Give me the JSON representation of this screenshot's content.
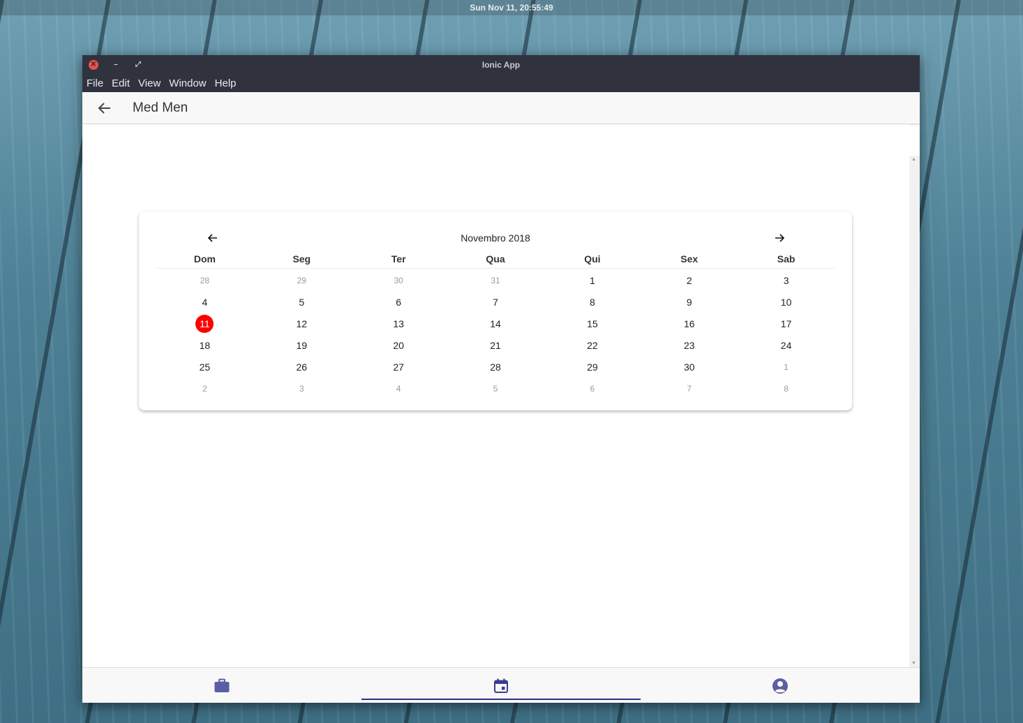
{
  "system": {
    "clock": "Sun Nov 11, 20:55:49"
  },
  "window": {
    "title": "Ionic App"
  },
  "menu": [
    "File",
    "Edit",
    "View",
    "Window",
    "Help"
  ],
  "header": {
    "title": "Med Men",
    "back_icon": "arrow-back-icon"
  },
  "calendar": {
    "month_label": "Novembro 2018",
    "prev_icon": "arrow-left-icon",
    "next_icon": "arrow-right-icon",
    "weekdays": [
      "Dom",
      "Seg",
      "Ter",
      "Qua",
      "Qui",
      "Sex",
      "Sab"
    ],
    "today": "11",
    "today_color": "#ff0000",
    "weeks": [
      [
        {
          "d": "28",
          "other": true
        },
        {
          "d": "29",
          "other": true
        },
        {
          "d": "30",
          "other": true
        },
        {
          "d": "31",
          "other": true
        },
        {
          "d": "1"
        },
        {
          "d": "2"
        },
        {
          "d": "3"
        }
      ],
      [
        {
          "d": "4"
        },
        {
          "d": "5"
        },
        {
          "d": "6"
        },
        {
          "d": "7"
        },
        {
          "d": "8"
        },
        {
          "d": "9"
        },
        {
          "d": "10"
        }
      ],
      [
        {
          "d": "11",
          "today": true
        },
        {
          "d": "12"
        },
        {
          "d": "13"
        },
        {
          "d": "14"
        },
        {
          "d": "15"
        },
        {
          "d": "16"
        },
        {
          "d": "17"
        }
      ],
      [
        {
          "d": "18"
        },
        {
          "d": "19"
        },
        {
          "d": "20"
        },
        {
          "d": "21"
        },
        {
          "d": "22"
        },
        {
          "d": "23"
        },
        {
          "d": "24"
        }
      ],
      [
        {
          "d": "25"
        },
        {
          "d": "26"
        },
        {
          "d": "27"
        },
        {
          "d": "28"
        },
        {
          "d": "29"
        },
        {
          "d": "30"
        },
        {
          "d": "1",
          "other": true
        }
      ],
      [
        {
          "d": "2",
          "other": true
        },
        {
          "d": "3",
          "other": true
        },
        {
          "d": "4",
          "other": true
        },
        {
          "d": "5",
          "other": true
        },
        {
          "d": "6",
          "other": true
        },
        {
          "d": "7",
          "other": true
        },
        {
          "d": "8",
          "other": true
        }
      ]
    ]
  },
  "tabs": [
    {
      "icon": "briefcase-icon",
      "active": false
    },
    {
      "icon": "calendar-icon",
      "active": true
    },
    {
      "icon": "person-circle-icon",
      "active": false
    }
  ],
  "colors": {
    "tab_icon": "#5b5ea6",
    "tab_indicator": "#2e3079",
    "titlebar": "#30333e"
  }
}
